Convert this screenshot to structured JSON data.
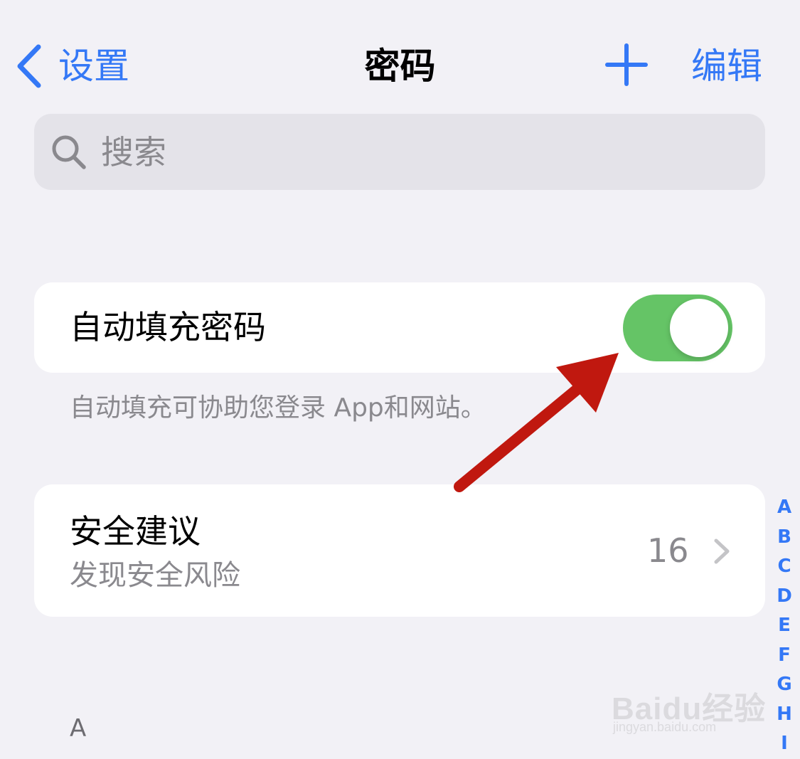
{
  "nav": {
    "back_label": "设置",
    "title": "密码",
    "edit_label": "编辑"
  },
  "search": {
    "placeholder": "搜索"
  },
  "autofill": {
    "label": "自动填充密码",
    "enabled": true,
    "footnote": "自动填充可协助您登录 App和网站。"
  },
  "security": {
    "title": "安全建议",
    "subtitle": "发现安全风险",
    "count": "16"
  },
  "index_letters": [
    "A",
    "B",
    "C",
    "D",
    "E",
    "F",
    "G",
    "H",
    "I"
  ],
  "section_header": "A",
  "watermark": {
    "brand": "Baidu经验",
    "url": "jingyan.baidu.com"
  },
  "colors": {
    "accent": "#3478f6",
    "toggle_on": "#65c466",
    "annotation": "#c0180f"
  }
}
